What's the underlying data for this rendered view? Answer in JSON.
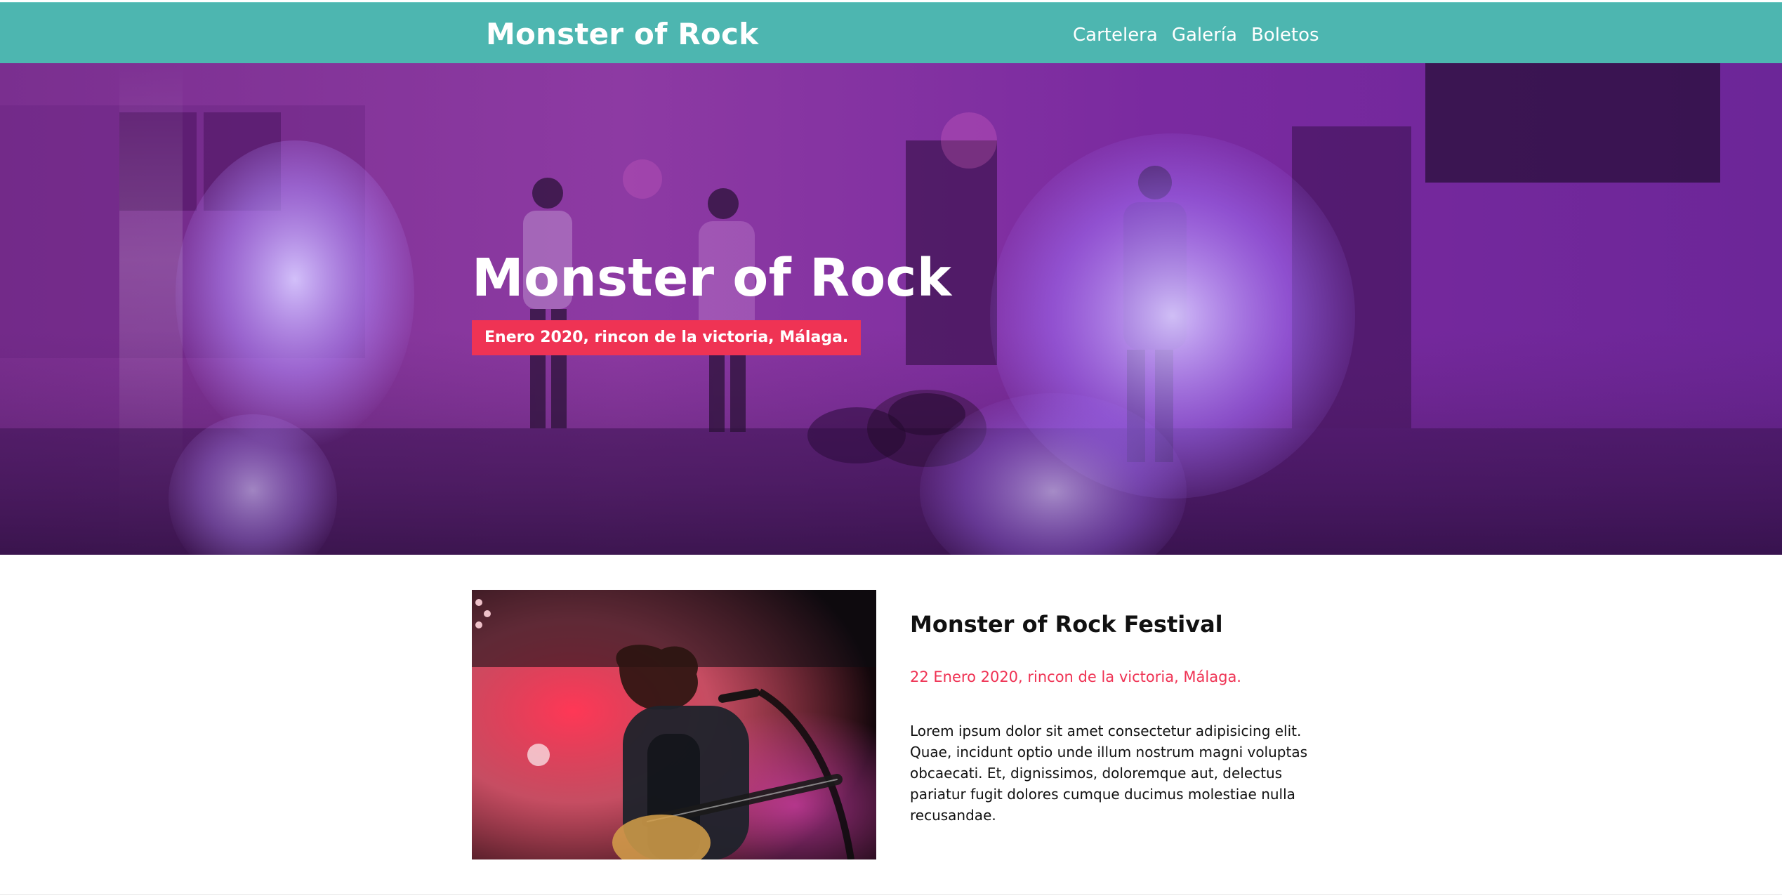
{
  "header": {
    "brand": "Monster of Rock",
    "nav": [
      {
        "label": "Cartelera"
      },
      {
        "label": "Galería"
      },
      {
        "label": "Boletos"
      }
    ]
  },
  "hero": {
    "title": "Monster of Rock",
    "badge": "Enero 2020, rincon de la victoria, Málaga."
  },
  "feature": {
    "title": "Monster of Rock Festival",
    "date": "22 Enero 2020, rincon de la victoria, Málaga.",
    "body": "Lorem ipsum dolor sit amet consectetur adipisicing elit. Quae, incidunt optio unde illum nostrum magni voluptas obcaecati. Et, dignissimos, doloremque aut, delectus pariatur fugit dolores cumque ducimus molestiae nulla recusandae."
  },
  "colors": {
    "teal": "#4db6b0",
    "accent": "#ef3354",
    "text": "#111111"
  }
}
